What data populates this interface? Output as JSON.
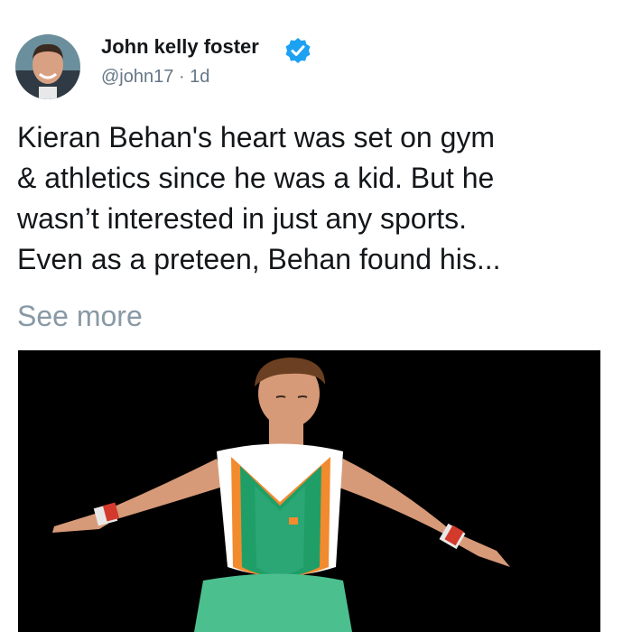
{
  "tweet": {
    "author": {
      "display_name": "John kelly foster",
      "verified": true,
      "handle": "@john17",
      "separator": "·",
      "time": "1d"
    },
    "text_lines": [
      "Kieran Behan's heart was set on gym",
      "& athletics since he was a kid. But he",
      "wasn’t interested in just any sports.",
      "Even as a preteen, Behan found his..."
    ],
    "see_more_label": "See more",
    "media": {
      "kind": "photo",
      "background": "#000000"
    }
  },
  "colors": {
    "text_primary": "#14171a",
    "text_secondary": "#657786",
    "see_more": "#8899a6",
    "verified_badge": "#1da1f2"
  },
  "icons": {
    "verified": "verified-badge-icon"
  }
}
